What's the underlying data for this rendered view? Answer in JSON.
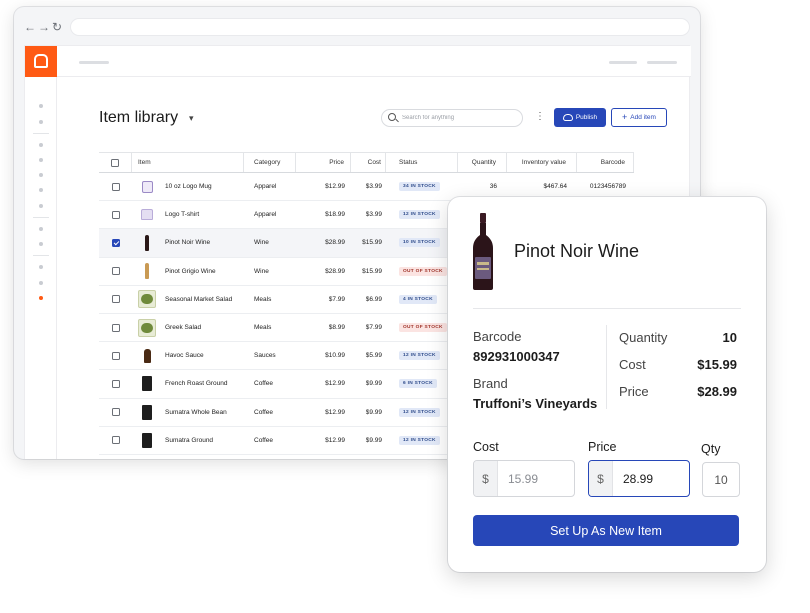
{
  "browser": {
    "nav": {
      "back": "←",
      "forward": "→",
      "reload": "↻"
    }
  },
  "header": {
    "title": "Item library",
    "search_placeholder": "Search for anything",
    "publish_label": "Publish",
    "add_item_label": "Add item"
  },
  "colors": {
    "brand": "#ff5a14",
    "primary": "#2747b8",
    "in_stock_badge": "#e1e8f7",
    "out_of_stock_badge": "#fbe4e2"
  },
  "table": {
    "columns": [
      "Item",
      "Category",
      "Price",
      "Cost",
      "Status",
      "Quantity",
      "Inventory value",
      "Barcode"
    ],
    "rows": [
      {
        "thumb": "mug",
        "name": "10 oz Logo Mug",
        "category": "Apparel",
        "price": "$12.99",
        "cost": "$3.99",
        "status": "34 IN STOCK",
        "status_type": "in",
        "quantity": "36",
        "inventory_value": "$467.64",
        "barcode": "0123456789",
        "checked": false
      },
      {
        "thumb": "shirt",
        "name": "Logo T-shirt",
        "category": "Apparel",
        "price": "$18.99",
        "cost": "$3.99",
        "status": "12 IN STOCK",
        "status_type": "in",
        "quantity": "",
        "inventory_value": "",
        "barcode": "",
        "checked": false
      },
      {
        "thumb": "bottle",
        "name": "Pinot Noir Wine",
        "category": "Wine",
        "price": "$28.99",
        "cost": "$15.99",
        "status": "10 IN STOCK",
        "status_type": "in",
        "quantity": "",
        "inventory_value": "",
        "barcode": "",
        "checked": true
      },
      {
        "thumb": "grigio",
        "name": "Pinot Grigio Wine",
        "category": "Wine",
        "price": "$28.99",
        "cost": "$15.99",
        "status": "OUT OF STOCK",
        "status_type": "out",
        "quantity": "",
        "inventory_value": "",
        "barcode": "",
        "checked": false
      },
      {
        "thumb": "salad",
        "name": "Seasonal Market Salad",
        "category": "Meals",
        "price": "$7.99",
        "cost": "$6.99",
        "status": "4 IN STOCK",
        "status_type": "in",
        "quantity": "",
        "inventory_value": "",
        "barcode": "",
        "checked": false
      },
      {
        "thumb": "salad",
        "name": "Greek Salad",
        "category": "Meals",
        "price": "$8.99",
        "cost": "$7.99",
        "status": "OUT OF STOCK",
        "status_type": "out",
        "quantity": "",
        "inventory_value": "",
        "barcode": "",
        "checked": false
      },
      {
        "thumb": "sauce",
        "name": "Havoc Sauce",
        "category": "Sauces",
        "price": "$10.99",
        "cost": "$5.99",
        "status": "12 IN STOCK",
        "status_type": "in",
        "quantity": "",
        "inventory_value": "",
        "barcode": "",
        "checked": false
      },
      {
        "thumb": "coffee",
        "name": "French Roast Ground",
        "category": "Coffee",
        "price": "$12.99",
        "cost": "$9.99",
        "status": "6 IN STOCK",
        "status_type": "in",
        "quantity": "",
        "inventory_value": "",
        "barcode": "",
        "checked": false
      },
      {
        "thumb": "coffee",
        "name": "Sumatra Whole Bean",
        "category": "Coffee",
        "price": "$12.99",
        "cost": "$9.99",
        "status": "12 IN STOCK",
        "status_type": "in",
        "quantity": "",
        "inventory_value": "",
        "barcode": "",
        "checked": false
      },
      {
        "thumb": "coffee",
        "name": "Sumatra Ground",
        "category": "Coffee",
        "price": "$12.99",
        "cost": "$9.99",
        "status": "12 IN STOCK",
        "status_type": "in",
        "quantity": "",
        "inventory_value": "",
        "barcode": "",
        "checked": false
      }
    ]
  },
  "detail": {
    "name": "Pinot Noir Wine",
    "barcode_label": "Barcode",
    "barcode": "892931000347",
    "brand_label": "Brand",
    "brand": "Truffoni’s Vineyards",
    "quantity_label": "Quantity",
    "quantity": "10",
    "cost_label": "Cost",
    "cost": "$15.99",
    "price_label": "Price",
    "price": "$28.99",
    "form": {
      "cost_label": "Cost",
      "price_label": "Price",
      "qty_label": "Qty",
      "currency": "$",
      "cost_value": "15.99",
      "price_value": "28.99",
      "qty_value": "10"
    },
    "setup_button": "Set Up As New Item"
  }
}
